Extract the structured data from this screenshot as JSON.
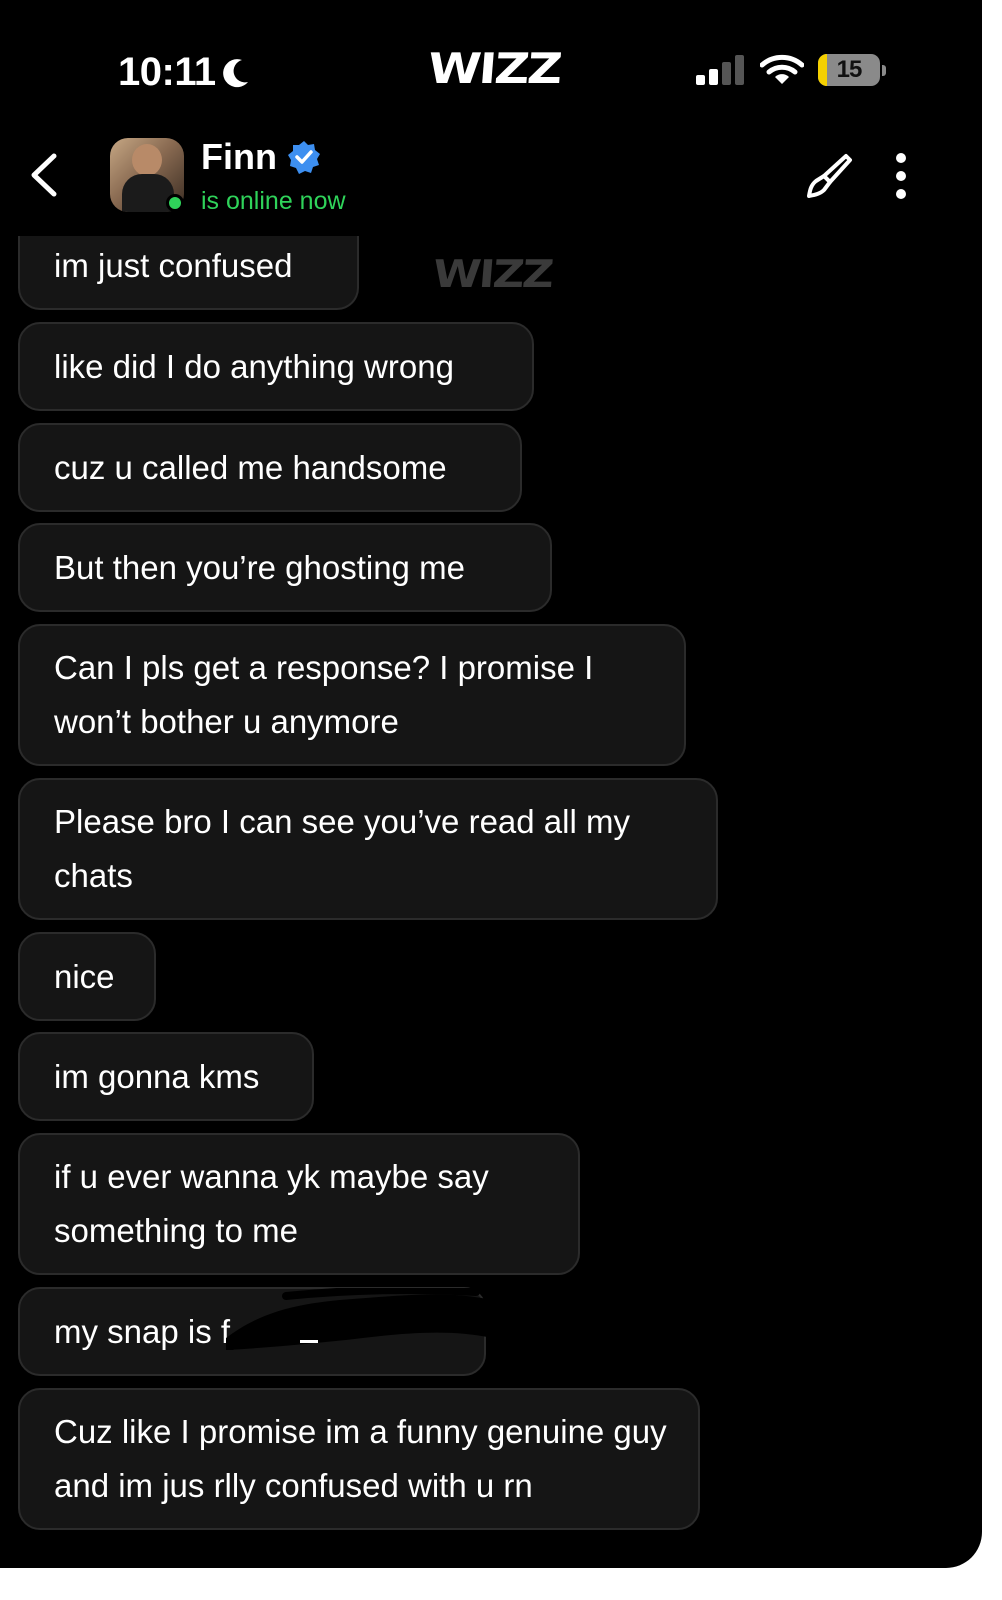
{
  "status_bar": {
    "time": "10:11",
    "battery_level": "15"
  },
  "app": {
    "brand": "WIZZ",
    "watermark": "WIZZ"
  },
  "header": {
    "contact_name": "Finn",
    "status_text": "is online now",
    "verified": true
  },
  "messages": [
    {
      "text": "im just confused"
    },
    {
      "text": "like did I do anything wrong"
    },
    {
      "text": "cuz u called me handsome"
    },
    {
      "text": "But then you’re ghosting me"
    },
    {
      "text": "Can I pls get a response? I promise I won’t bother u anymore"
    },
    {
      "text": "Please bro I can see you’ve read all my chats"
    },
    {
      "text": "nice"
    },
    {
      "text": "im gonna kms"
    },
    {
      "text": "if u ever wanna yk maybe say something to me"
    },
    {
      "text": "my snap is f"
    },
    {
      "text": "Cuz like I promise im a funny genuine guy and im jus rlly confused with u rn"
    }
  ],
  "colors": {
    "background": "#000000",
    "bubble": "#151515",
    "bubble_border": "#2b2b2b",
    "online": "#2fd35a",
    "verified": "#3d8ff0",
    "battery_fill": "#f5d000"
  },
  "icons": [
    "moon-icon",
    "cellular-signal-icon",
    "wifi-icon",
    "battery-icon",
    "back-chevron-icon",
    "verified-badge-icon",
    "brush-icon",
    "more-vertical-icon"
  ]
}
